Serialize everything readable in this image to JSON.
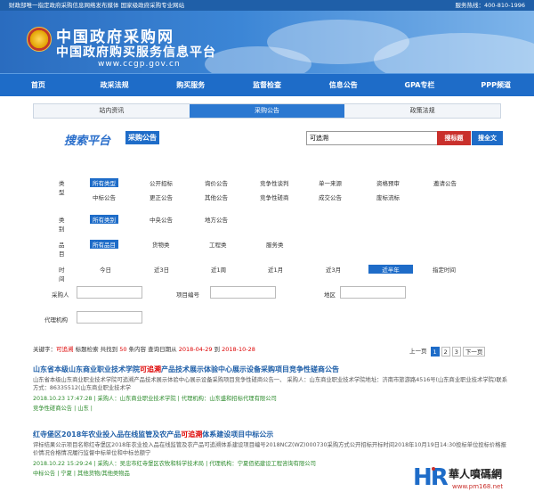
{
  "topbar": {
    "left": "财政部唯一指定政府采购信息网络发布媒体  国家级政府采购专业网站",
    "right": "服务热线：400-810-1996"
  },
  "header": {
    "name": "中国政府采购网",
    "subname": "中国政府购买服务信息平台",
    "url": "www.ccgp.gov.cn"
  },
  "nav": [
    "首页",
    "政采法规",
    "购买服务",
    "监督检查",
    "信息公告",
    "GPA专栏",
    "PPP频道"
  ],
  "subtabs": [
    {
      "label": "站内资讯",
      "active": false
    },
    {
      "label": "采购公告",
      "active": true
    },
    {
      "label": "政策法规",
      "active": false
    }
  ],
  "search": {
    "logo": "搜索平台",
    "tag": "采购公告",
    "query": "可追溯",
    "btn_title": "搜标题",
    "btn_full": "搜全文"
  },
  "filters": {
    "type_label": "类型",
    "type_row1": [
      "所有类型",
      "公开招标",
      "询价公告",
      "竞争性谈判",
      "单一来源",
      "资格预审",
      "邀请公告"
    ],
    "type_row2": [
      "中标公告",
      "更正公告",
      "其他公告",
      "竞争性磋商",
      "成交公告",
      "废标流标"
    ],
    "cat_label": "类别",
    "cat_opts": [
      "所有类别",
      "中央公告",
      "地方公告"
    ],
    "item_label": "品目",
    "item_opts": [
      "所有品目",
      "货物类",
      "工程类",
      "服务类"
    ],
    "time_label": "时间",
    "time_opts": [
      "今日",
      "近3日",
      "近1周",
      "近1月",
      "近3月",
      "近半年",
      "指定时间"
    ],
    "buyer_label": "采购人",
    "project_label": "项目编号",
    "region_label": "地区",
    "agency_label": "代理机构"
  },
  "summary": {
    "prefix": "关键字：",
    "keyword": "可追溯",
    "mid": " 标题检索 共找到 ",
    "count": "50",
    "range_prefix": " 条内容 查询日期从 ",
    "from": "2018-04-29",
    "to_word": " 到 ",
    "to": "2018-10-28"
  },
  "pager": {
    "prev": "上一页",
    "pages": [
      "1",
      "2",
      "3"
    ],
    "next": "下一页"
  },
  "results": [
    {
      "title_pre": "山东省本级山东商业职业技术学院",
      "title_hl": "可追溯",
      "title_post": "产品技术展示体验中心展示设备采购项目竞争性磋商公告",
      "text": "山东省本级山东商业职业技术学院可追溯产品技术展示体验中心展示设备采购项目竞争性磋商公告一、 采购人：山东商业职业技术学院地址：济南市旅游路4516号(山东商业职业技术学院)联系方式：86335512(山东商业职业技术学",
      "meta": "2018.10.23 17:47:28 | 采购人：山东商业职业技术学院 | 代理机构：山东盛和招标代理有限公司",
      "tag": "竞争性磋商公告 | 山东 |"
    },
    {
      "title_pre": "红寺堡区2018年农业投入品在线监管及农产品",
      "title_hl": "可追溯",
      "title_post": "体系建设项目中标公示",
      "text": "评标结果公示项目名称红寺堡区2018年农业投入品在线监管及农产品可追溯体系建设项目编号2018NCZ(WZ)000730采购方式公开招标开标时间2018年10月19日14:30投标单位投标价格报价情况合格情况履行监督中标单位和中标总额宁",
      "meta": "2018.10.22 15:29:24 | 采购人：吴忠市红寺堡区农牧和科学技术局 | 代理机构：宁夏佰拓建设工程咨询有限公司",
      "tag": "中标公告 | 宁夏 | 其他货物/其他类物品"
    }
  ],
  "watermark": {
    "hr": "HR",
    "cn": "華人噴碼網",
    "url": "www.pm168.net"
  },
  "colors": {
    "brand_blue": "#1e6cc8",
    "red": "#c9302c"
  }
}
